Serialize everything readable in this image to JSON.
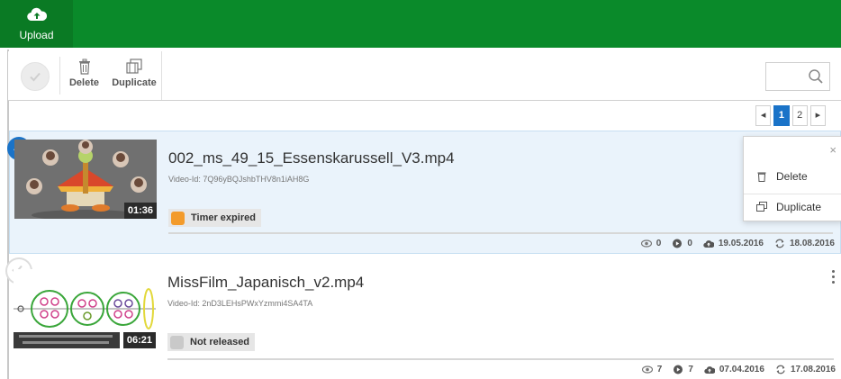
{
  "topbar": {
    "upload_label": "Upload"
  },
  "toolbar": {
    "delete_label": "Delete",
    "duplicate_label": "Duplicate",
    "search_placeholder": ""
  },
  "pagination": {
    "prev": "◂",
    "pages": [
      "1",
      "2"
    ],
    "next": "▸",
    "current": "1"
  },
  "videos": [
    {
      "title": "002_ms_49_15_Essenskarussell_V3.mp4",
      "video_id": "Video-Id: 7Q96yBQJshbTHV8n1iAH8G",
      "duration": "01:36",
      "status": "Timer expired",
      "views": "0",
      "plays": "0",
      "uploaded": "19.05.2016",
      "updated": "18.08.2016",
      "selected": true
    },
    {
      "title": "MissFilm_Japanisch_v2.mp4",
      "video_id": "Video-Id: 2nD3LEHsPWxYzmmi4SA4TA",
      "duration": "06:21",
      "status": "Not released",
      "views": "7",
      "plays": "7",
      "uploaded": "07.04.2016",
      "updated": "17.08.2016",
      "selected": false
    }
  ],
  "context_menu": {
    "close": "×",
    "delete_label": "Delete",
    "duplicate_label": "Duplicate"
  },
  "colors": {
    "brand_green": "#0a8a2a",
    "accent_blue": "#1a73c8",
    "status_orange": "#f39b2b"
  }
}
